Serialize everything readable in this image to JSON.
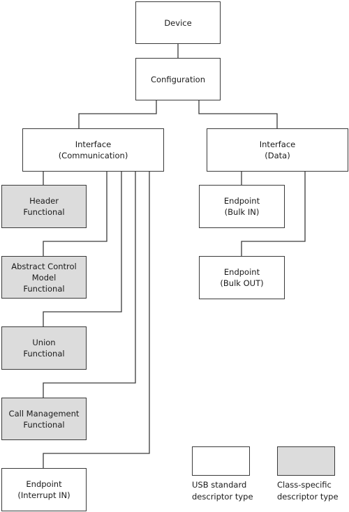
{
  "nodes": {
    "device": {
      "lines": [
        "Device"
      ],
      "kind": "standard"
    },
    "configuration": {
      "lines": [
        "Configuration"
      ],
      "kind": "standard"
    },
    "interface_comm": {
      "lines": [
        "Interface",
        "(Communication)"
      ],
      "kind": "standard"
    },
    "interface_data": {
      "lines": [
        "Interface",
        "(Data)"
      ],
      "kind": "standard"
    },
    "header_functional": {
      "lines": [
        "Header",
        "Functional"
      ],
      "kind": "class-specific"
    },
    "acm_functional": {
      "lines": [
        "Abstract Control",
        "Model",
        "Functional"
      ],
      "kind": "class-specific"
    },
    "union_functional": {
      "lines": [
        "Union",
        "Functional"
      ],
      "kind": "class-specific"
    },
    "call_mgmt_functional": {
      "lines": [
        "Call Management",
        "Functional"
      ],
      "kind": "class-specific"
    },
    "endpoint_interrupt_in": {
      "lines": [
        "Endpoint",
        "(Interrupt IN)"
      ],
      "kind": "standard"
    },
    "endpoint_bulk_in": {
      "lines": [
        "Endpoint",
        "(Bulk IN)"
      ],
      "kind": "standard"
    },
    "endpoint_bulk_out": {
      "lines": [
        "Endpoint",
        "(Bulk OUT)"
      ],
      "kind": "standard"
    }
  },
  "edges": [
    [
      "device",
      "configuration"
    ],
    [
      "configuration",
      "interface_comm"
    ],
    [
      "configuration",
      "interface_data"
    ],
    [
      "interface_comm",
      "header_functional"
    ],
    [
      "interface_comm",
      "acm_functional"
    ],
    [
      "interface_comm",
      "union_functional"
    ],
    [
      "interface_comm",
      "call_mgmt_functional"
    ],
    [
      "interface_comm",
      "endpoint_interrupt_in"
    ],
    [
      "interface_data",
      "endpoint_bulk_in"
    ],
    [
      "interface_data",
      "endpoint_bulk_out"
    ]
  ],
  "legend": {
    "standard": {
      "lines": [
        "USB standard",
        "descriptor type"
      ],
      "color": "#ffffff"
    },
    "class_specific": {
      "lines": [
        "Class-specific",
        "descriptor type"
      ],
      "color": "#dcdcdc"
    }
  },
  "colors": {
    "line": "#3a3a3a",
    "class_fill": "#dcdcdc",
    "standard_fill": "#ffffff"
  }
}
